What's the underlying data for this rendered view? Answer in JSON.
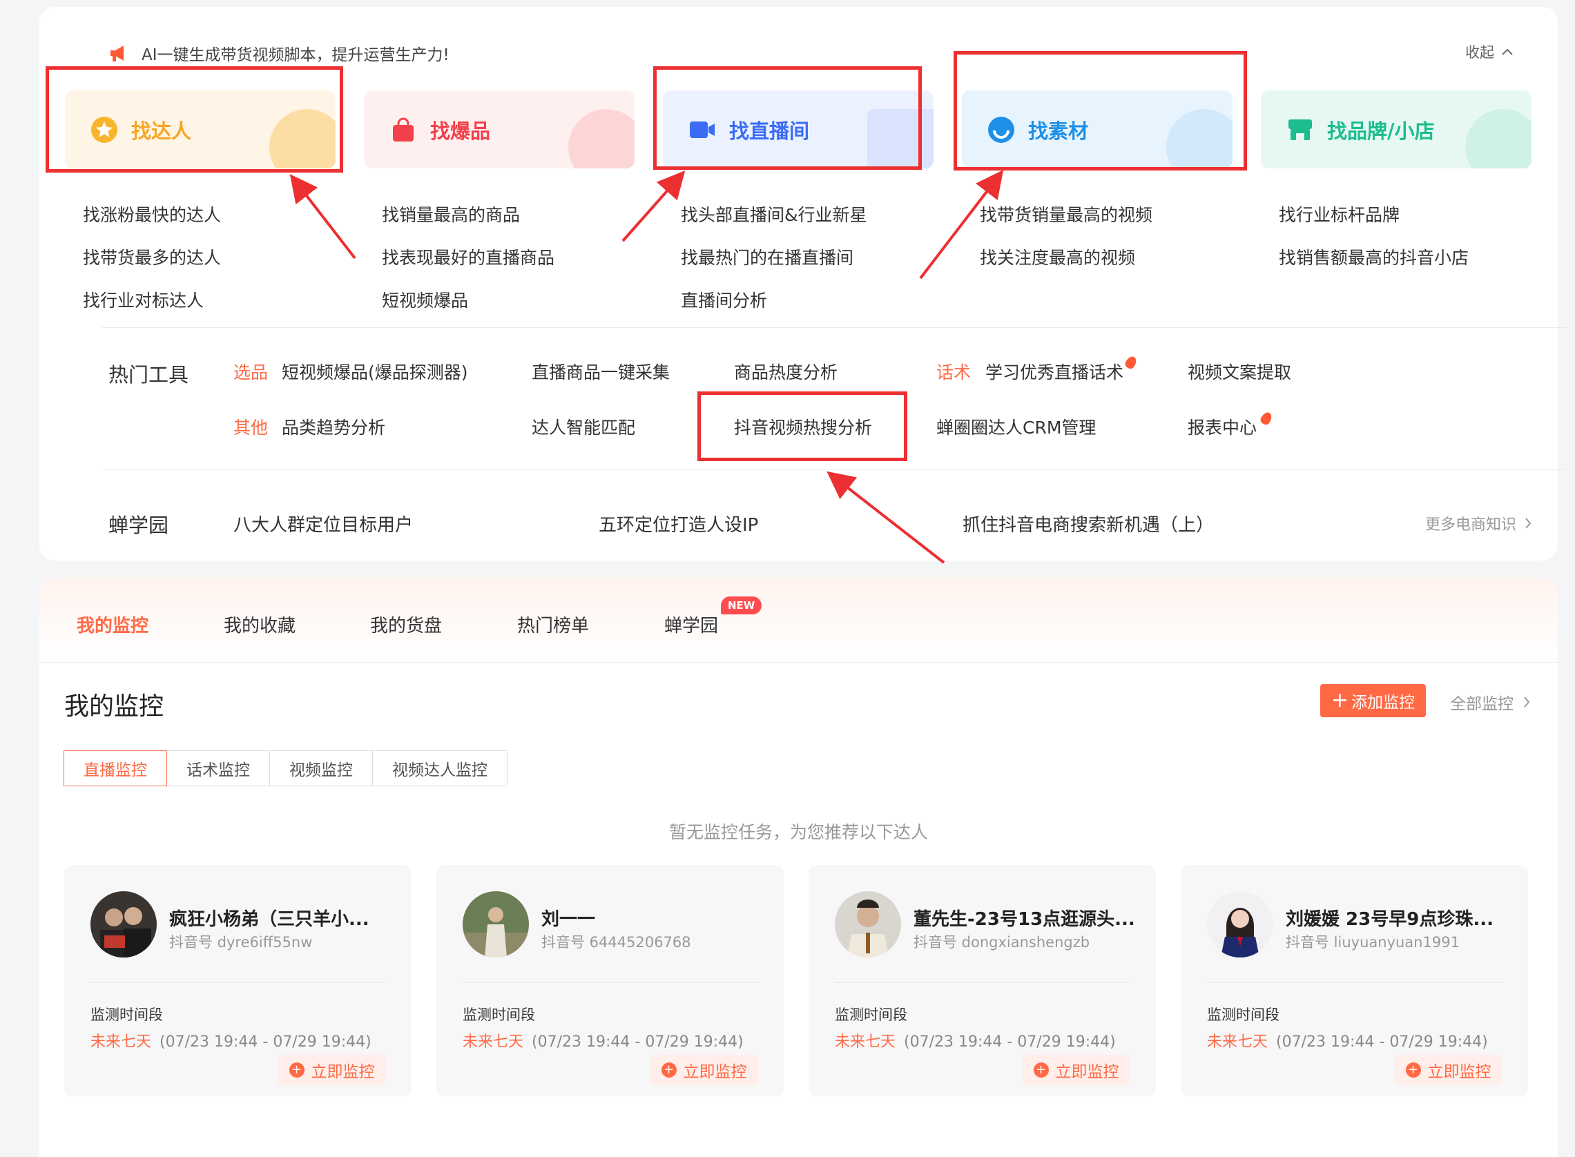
{
  "banner": {
    "text": "AI一键生成带货视频脚本，提升运营生产力!",
    "collapse_label": "收起"
  },
  "categories": [
    {
      "title": "找达人",
      "color": "#f5a623",
      "links": [
        "找涨粉最快的达人",
        "找带货最多的达人",
        "找行业对标达人"
      ]
    },
    {
      "title": "找爆品",
      "color": "#f2414a",
      "links": [
        "找销量最高的商品",
        "找表现最好的直播商品",
        "短视频爆品"
      ]
    },
    {
      "title": "找直播间",
      "color": "#3b6cf6",
      "links": [
        "找头部直播间&行业新星",
        "找最热门的在播直播间",
        "直播间分析"
      ]
    },
    {
      "title": "找素材",
      "color": "#1e90e8",
      "links": [
        "找带货销量最高的视频",
        "找关注度最高的视频"
      ]
    },
    {
      "title": "找品牌/小店",
      "color": "#1bbd8e",
      "links": [
        "找行业标杆品牌",
        "找销售额最高的抖音小店"
      ]
    }
  ],
  "hot_tools": {
    "title": "热门工具",
    "row1_tag": "选品",
    "row2_tag": "其他",
    "row3_tag": "话术",
    "items": [
      "短视频爆品(爆品探测器)",
      "直播商品一键采集",
      "商品热度分析",
      "学习优秀直播话术",
      "视频文案提取",
      "品类趋势分析",
      "达人智能匹配",
      "抖音视频热搜分析",
      "蝉圈圈达人CRM管理",
      "报表中心"
    ]
  },
  "academy": {
    "title": "蝉学园",
    "items": [
      "八大人群定位目标用户",
      "五环定位打造人设IP",
      "抓住抖音电商搜索新机遇（上）"
    ],
    "more_label": "更多电商知识"
  },
  "main_tabs": [
    "我的监控",
    "我的收藏",
    "我的货盘",
    "热门榜单",
    "蝉学园"
  ],
  "new_badge": "NEW",
  "monitor": {
    "title": "我的监控",
    "add_label": "添加监控",
    "all_label": "全部监控",
    "sub_tabs": [
      "直播监控",
      "话术监控",
      "视频监控",
      "视频达人监控"
    ],
    "empty_hint": "暂无监控任务，为您推荐以下达人"
  },
  "talents": [
    {
      "name": "疯狂小杨弟（三只羊小...",
      "id": "抖音号 dyre6iff55nw",
      "period_label": "监测时间段",
      "future": "未来七天",
      "dates": "(07/23 19:44 - 07/29 19:44)",
      "btn": "立即监控"
    },
    {
      "name": "刘一一",
      "id": "抖音号 64445206768",
      "period_label": "监测时间段",
      "future": "未来七天",
      "dates": "(07/23 19:44 - 07/29 19:44)",
      "btn": "立即监控"
    },
    {
      "name": "董先生-23号13点逛源头...",
      "id": "抖音号 dongxianshengzb",
      "period_label": "监测时间段",
      "future": "未来七天",
      "dates": "(07/23 19:44 - 07/29 19:44)",
      "btn": "立即监控"
    },
    {
      "name": "刘媛媛 23号早9点珍珠...",
      "id": "抖音号 liuyuanyuan1991",
      "period_label": "监测时间段",
      "future": "未来七天",
      "dates": "(07/23 19:44 - 07/29 19:44)",
      "btn": "立即监控"
    }
  ],
  "colors": {
    "accent": "#ff6a45",
    "highlight": "#ec2f31"
  }
}
